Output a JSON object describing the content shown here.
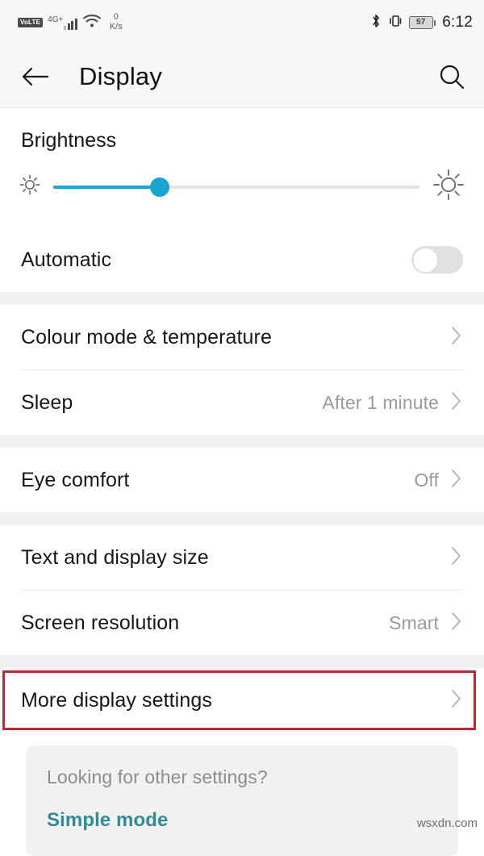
{
  "status_bar": {
    "volte_label": "VoLTE",
    "network_label": "4G+",
    "data_rate_value": "0",
    "data_rate_unit": "K/s",
    "bluetooth_icon": "bluetooth-icon",
    "vibrate_icon": "vibrate-icon",
    "battery_percent": "57",
    "time": "6:12"
  },
  "app_bar": {
    "back_icon": "back-arrow-icon",
    "title": "Display",
    "search_icon": "search-icon"
  },
  "brightness": {
    "title": "Brightness",
    "low_icon": "brightness-low-icon",
    "high_icon": "brightness-high-icon",
    "slider_percent": 29
  },
  "automatic": {
    "label": "Automatic",
    "state": "off"
  },
  "settings_groups": [
    {
      "rows": [
        {
          "label": "Colour mode & temperature",
          "value": ""
        },
        {
          "label": "Sleep",
          "value": "After 1 minute"
        }
      ]
    },
    {
      "rows": [
        {
          "label": "Eye comfort",
          "value": "Off"
        }
      ]
    },
    {
      "rows": [
        {
          "label": "Text and display size",
          "value": ""
        },
        {
          "label": "Screen resolution",
          "value": "Smart"
        }
      ]
    },
    {
      "rows": [
        {
          "label": "More display settings",
          "value": ""
        }
      ]
    }
  ],
  "footer": {
    "question": "Looking for other settings?",
    "link_label": "Simple mode"
  },
  "watermark": "wsxdn.com",
  "colors": {
    "accent_slider": "#18a5d0",
    "link_teal": "#2f8b96",
    "highlight_red": "#c0272d",
    "section_gap": "#f1f1f3"
  }
}
